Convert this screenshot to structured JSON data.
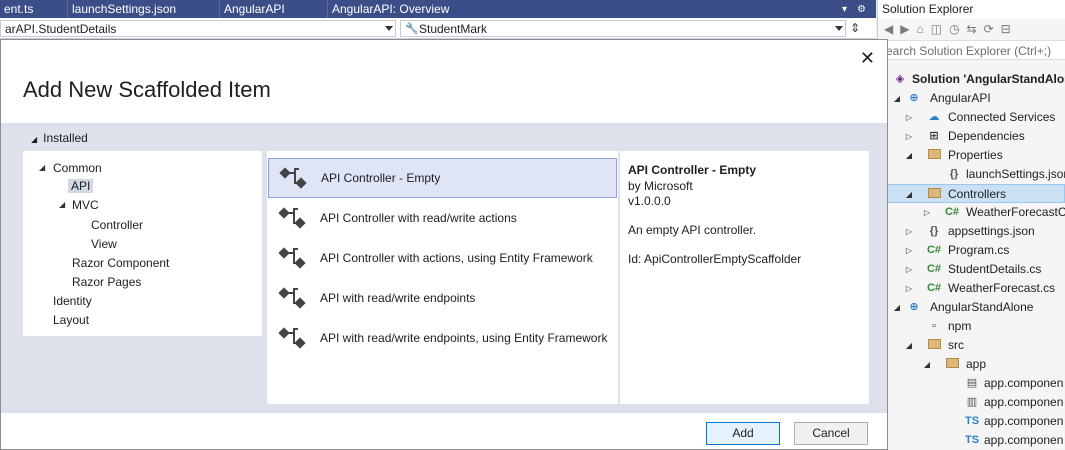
{
  "editor": {
    "tabs": [
      "ent.ts",
      "launchSettings.json",
      "AngularAPI",
      "AngularAPI: Overview"
    ],
    "nav_left": "arAPI.StudentDetails",
    "nav_right": "StudentMark"
  },
  "solution_explorer": {
    "title": "Solution Explorer",
    "search_placeholder": "earch Solution Explorer (Ctrl+;)",
    "nodes": [
      {
        "label": "Solution 'AngularStandAlone",
        "icon": "solution-icon"
      },
      {
        "label": "AngularAPI",
        "icon": "globe-icon"
      },
      {
        "label": "Connected Services",
        "icon": "cloud-icon"
      },
      {
        "label": "Dependencies",
        "icon": "dependencies-icon"
      },
      {
        "label": "Properties",
        "icon": "wrench-folder-icon"
      },
      {
        "label": "launchSettings.json",
        "icon": "json-file-icon"
      },
      {
        "label": "Controllers",
        "icon": "folder-icon"
      },
      {
        "label": "WeatherForecastCo",
        "icon": "csharp-icon"
      },
      {
        "label": "appsettings.json",
        "icon": "json-file-icon"
      },
      {
        "label": "Program.cs",
        "icon": "csharp-icon"
      },
      {
        "label": "StudentDetails.cs",
        "icon": "csharp-icon"
      },
      {
        "label": "WeatherForecast.cs",
        "icon": "csharp-icon"
      },
      {
        "label": "AngularStandAlone",
        "icon": "globe-icon"
      },
      {
        "label": "npm",
        "icon": "npm-icon"
      },
      {
        "label": "src",
        "icon": "folder-icon"
      },
      {
        "label": "app",
        "icon": "folder-icon"
      },
      {
        "label": "app.componen",
        "icon": "html-file-icon"
      },
      {
        "label": "app.componen",
        "icon": "css-file-icon"
      },
      {
        "label": "app.componen",
        "icon": "ts-file-icon"
      },
      {
        "label": "app.componen",
        "icon": "ts-file-icon"
      }
    ],
    "csharp_glyph": "C#",
    "ts_glyph": "TS"
  },
  "dialog": {
    "title": "Add New Scaffolded Item",
    "installed_label": "Installed",
    "categories": {
      "common": "Common",
      "api": "API",
      "mvc": "MVC",
      "controller": "Controller",
      "view": "View",
      "razor_component": "Razor Component",
      "razor_pages": "Razor Pages",
      "identity": "Identity",
      "layout": "Layout"
    },
    "items": [
      "API Controller - Empty",
      "API Controller with read/write actions",
      "API Controller with actions, using Entity Framework",
      "API with read/write endpoints",
      "API with read/write endpoints, using Entity Framework"
    ],
    "details": {
      "title": "API Controller - Empty",
      "author": "by Microsoft",
      "version": "v1.0.0.0",
      "description": "An empty API controller.",
      "id": "Id: ApiControllerEmptyScaffolder"
    },
    "buttons": {
      "add": "Add",
      "cancel": "Cancel"
    }
  },
  "colors": {
    "tab_bar": "#3c4e88",
    "selected_item": "#dfe5f7",
    "dialog_band": "#dce1ec",
    "folder": "#dcb67a",
    "csharp": "#388a34"
  }
}
